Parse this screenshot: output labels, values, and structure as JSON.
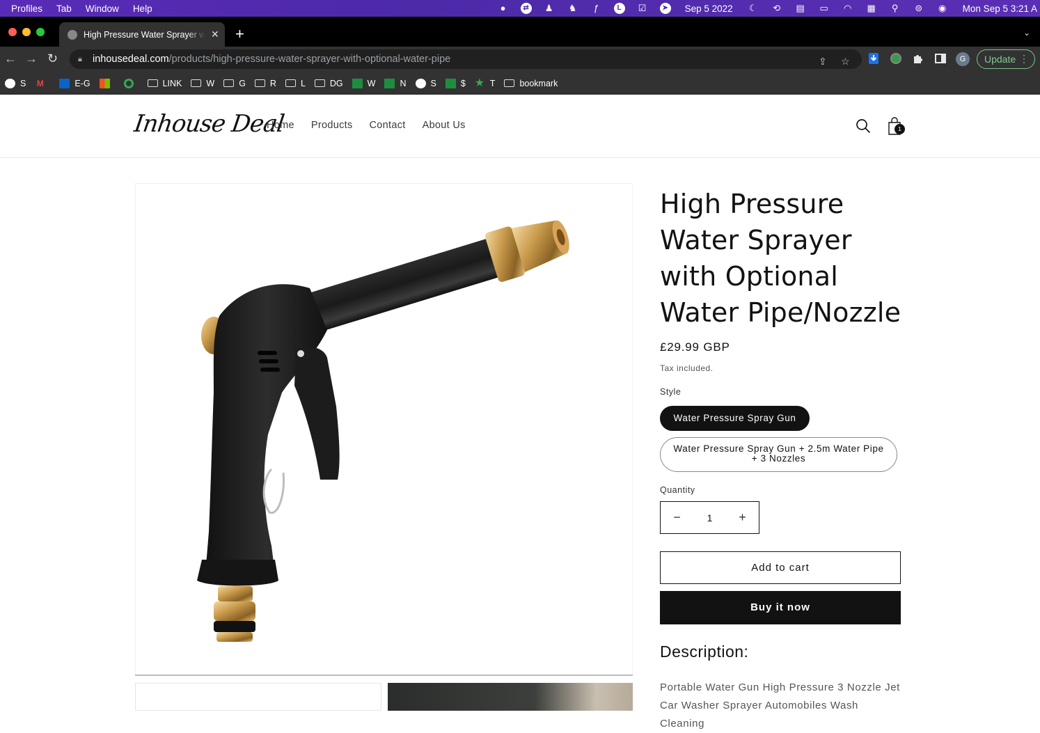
{
  "menubar": {
    "items": [
      "Profiles",
      "Tab",
      "Window",
      "Help"
    ],
    "date_short": "Sep 5 2022",
    "clock": "Mon Sep 5  3:21 A"
  },
  "tab": {
    "title": "High Pressure Water Sprayer w",
    "close": "✕"
  },
  "address": {
    "domain": "inhousedeal.com",
    "path": "/products/high-pressure-water-sprayer-with-optional-water-pipe"
  },
  "toolbar": {
    "update_label": "Update",
    "profile_initial": "G"
  },
  "bookmarks": [
    {
      "icon": "globe-icon",
      "label": "S"
    },
    {
      "icon": "gmail-icon",
      "label": ""
    },
    {
      "icon": "outlook-icon",
      "label": "E-G"
    },
    {
      "icon": "microsoft-icon",
      "label": ""
    },
    {
      "icon": "grammarly-icon",
      "label": ""
    },
    {
      "icon": "folder-icon",
      "label": "LINK"
    },
    {
      "icon": "folder-icon",
      "label": "W"
    },
    {
      "icon": "folder-icon",
      "label": "G"
    },
    {
      "icon": "folder-icon",
      "label": "R"
    },
    {
      "icon": "folder-icon",
      "label": "L"
    },
    {
      "icon": "folder-icon",
      "label": "DG"
    },
    {
      "icon": "sheet-icon",
      "label": "W"
    },
    {
      "icon": "sheet-icon",
      "label": "N"
    },
    {
      "icon": "globe-icon",
      "label": "S"
    },
    {
      "icon": "sheet-icon",
      "label": "$"
    },
    {
      "icon": "star-icon",
      "label": "T"
    },
    {
      "icon": "folder-icon",
      "label": "bookmark"
    }
  ],
  "site": {
    "logo": "Inhouse Deal",
    "nav": [
      "Home",
      "Products",
      "Contact",
      "About Us"
    ],
    "cart_count": "1"
  },
  "product": {
    "title": "High Pressure Water Sprayer with Optional Water Pipe/Nozzle",
    "price": "£29.99 GBP",
    "tax_note": "Tax included.",
    "style_label": "Style",
    "style_options": [
      "Water Pressure Spray Gun",
      "Water Pressure Spray Gun + 2.5m Water Pipe + 3 Nozzles"
    ],
    "selected_style_index": 0,
    "quantity_label": "Quantity",
    "quantity": "1",
    "minus": "−",
    "plus": "+",
    "add_to_cart": "Add to cart",
    "buy_now": "Buy it now",
    "description_heading": "Description:",
    "description_text": "Portable Water Gun High Pressure 3 Nozzle Jet Car Washer Sprayer Automobiles Wash Cleaning"
  }
}
